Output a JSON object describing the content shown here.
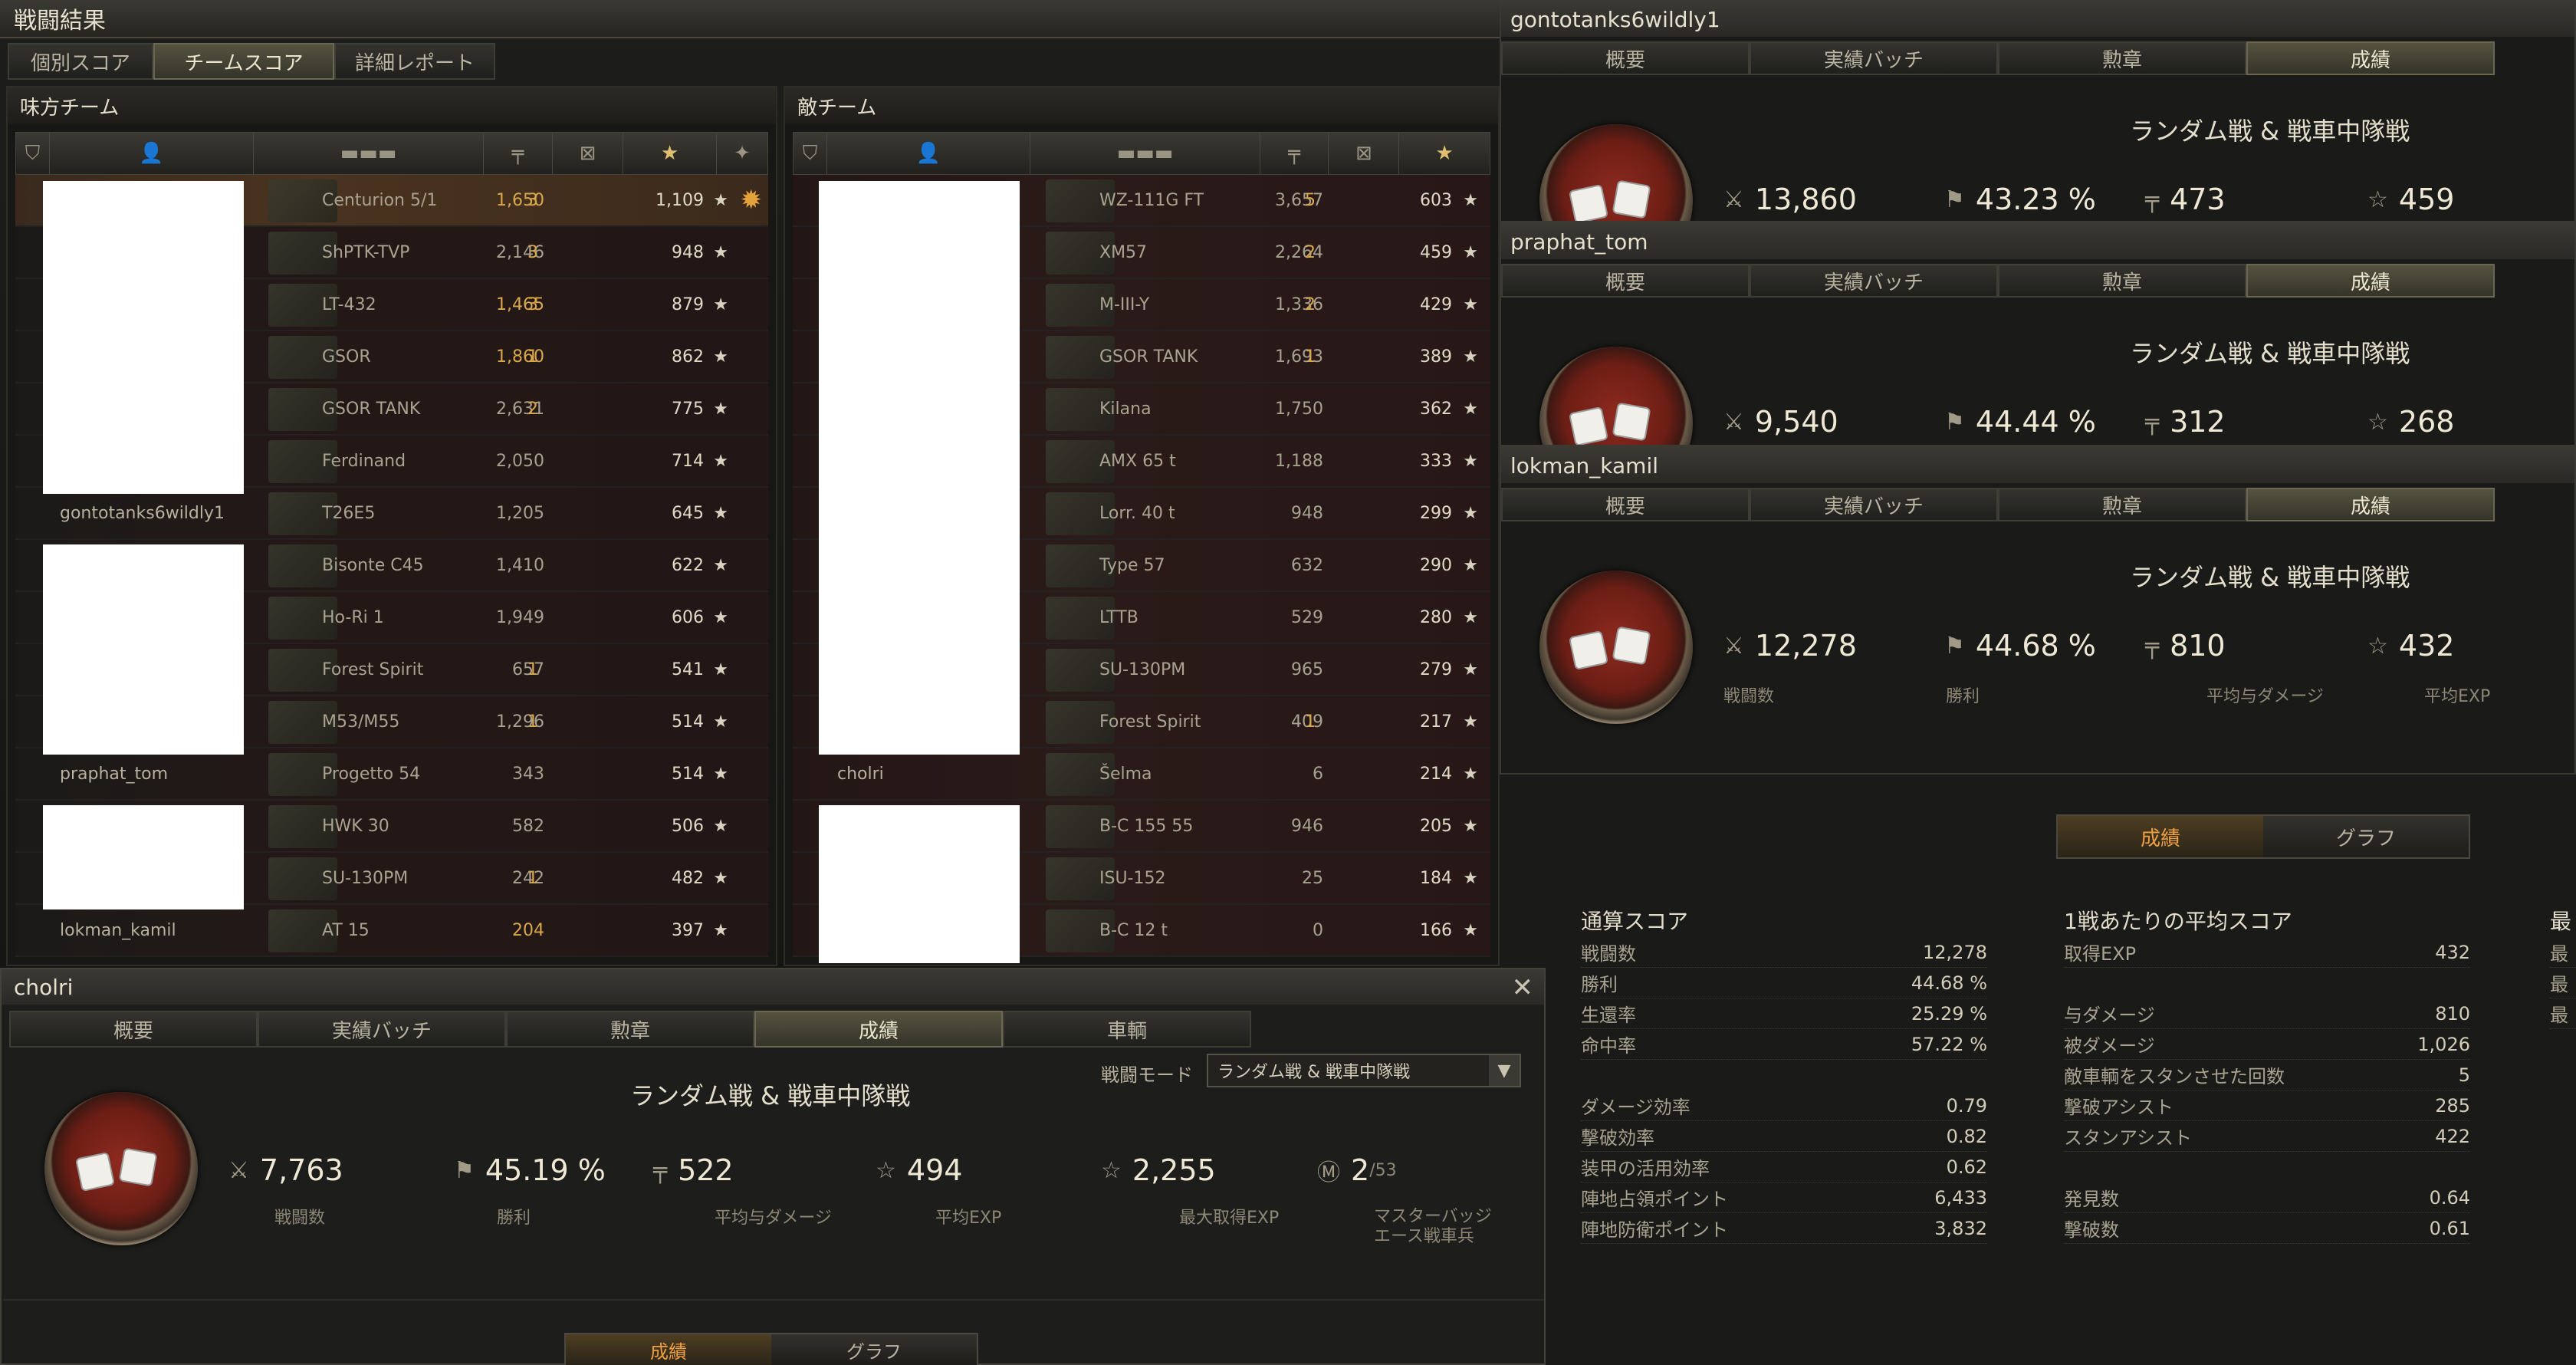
{
  "window": {
    "title": "戦闘結果"
  },
  "main_tabs": [
    {
      "label": "個別スコア",
      "active": false
    },
    {
      "label": "チームスコア",
      "active": true
    },
    {
      "label": "詳細レポート",
      "active": false
    }
  ],
  "ally": {
    "title": "味方チーム",
    "rows": [
      {
        "player": "",
        "tank": "Centurion 5/1",
        "damage": "1,650",
        "kills": "3",
        "xp": "1,109",
        "dmg_hi": true,
        "me": true,
        "badge": true
      },
      {
        "player": "",
        "tank": "ShPTK-TVP",
        "damage": "2,146",
        "kills": "3",
        "xp": "948",
        "dmg_hi": false
      },
      {
        "player": "",
        "tank": "LT-432",
        "damage": "1,465",
        "kills": "3",
        "xp": "879",
        "dmg_hi": true
      },
      {
        "player": "",
        "tank": "GSOR",
        "damage": "1,860",
        "kills": "1",
        "xp": "862",
        "dmg_hi": true
      },
      {
        "player": "",
        "tank": "GSOR TANK",
        "damage": "2,631",
        "kills": "2",
        "xp": "775",
        "dmg_hi": false
      },
      {
        "player": "",
        "tank": "Ferdinand",
        "damage": "2,050",
        "kills": "",
        "xp": "714",
        "dmg_hi": false
      },
      {
        "player": "gontotanks6wildly1",
        "tank": "T26E5",
        "damage": "1,205",
        "kills": "",
        "xp": "645",
        "dmg_hi": false
      },
      {
        "player": "",
        "tank": "Bisonte C45",
        "damage": "1,410",
        "kills": "",
        "xp": "622",
        "dmg_hi": false
      },
      {
        "player": "",
        "tank": "Ho-Ri 1",
        "damage": "1,949",
        "kills": "",
        "xp": "606",
        "dmg_hi": false
      },
      {
        "player": "",
        "tank": "Forest Spirit",
        "damage": "657",
        "kills": "1",
        "xp": "541",
        "dmg_hi": false
      },
      {
        "player": "",
        "tank": "M53/M55",
        "damage": "1,296",
        "kills": "1",
        "xp": "514",
        "dmg_hi": false
      },
      {
        "player": "praphat_tom",
        "tank": "Progetto 54",
        "damage": "343",
        "kills": "",
        "xp": "514",
        "dmg_hi": false
      },
      {
        "player": "",
        "tank": "HWK 30",
        "damage": "582",
        "kills": "",
        "xp": "506",
        "dmg_hi": false
      },
      {
        "player": "",
        "tank": "SU-130PM",
        "damage": "242",
        "kills": "1",
        "xp": "482",
        "dmg_hi": false
      },
      {
        "player": "lokman_kamil",
        "tank": "AT 15",
        "damage": "204",
        "kills": "",
        "xp": "397",
        "dmg_hi": true
      }
    ]
  },
  "enemy": {
    "title": "敵チーム",
    "rows": [
      {
        "player": "",
        "tank": "WZ-111G FT",
        "damage": "3,657",
        "kills": "5",
        "xp": "603"
      },
      {
        "player": "",
        "tank": "XM57",
        "damage": "2,264",
        "kills": "2",
        "xp": "459"
      },
      {
        "player": "",
        "tank": "M-III-Y",
        "damage": "1,336",
        "kills": "2",
        "xp": "429"
      },
      {
        "player": "",
        "tank": "GSOR TANK",
        "damage": "1,693",
        "kills": "1",
        "xp": "389"
      },
      {
        "player": "",
        "tank": "Kilana",
        "damage": "1,750",
        "kills": "",
        "xp": "362"
      },
      {
        "player": "",
        "tank": "AMX 65 t",
        "damage": "1,188",
        "kills": "",
        "xp": "333"
      },
      {
        "player": "",
        "tank": "Lorr. 40 t",
        "damage": "948",
        "kills": "",
        "xp": "299"
      },
      {
        "player": "",
        "tank": "Type 57",
        "damage": "632",
        "kills": "",
        "xp": "290"
      },
      {
        "player": "",
        "tank": "LTTB",
        "damage": "529",
        "kills": "",
        "xp": "280"
      },
      {
        "player": "",
        "tank": "SU-130PM",
        "damage": "965",
        "kills": "",
        "xp": "279"
      },
      {
        "player": "",
        "tank": "Forest Spirit",
        "damage": "409",
        "kills": "1",
        "xp": "217"
      },
      {
        "player": "cholri",
        "tank": "Šelma",
        "damage": "6",
        "kills": "",
        "xp": "214"
      },
      {
        "player": "",
        "tank": "B-C 155 55",
        "damage": "946",
        "kills": "",
        "xp": "205"
      },
      {
        "player": "",
        "tank": "ISU-152",
        "damage": "25",
        "kills": "",
        "xp": "184"
      },
      {
        "player": "",
        "tank": "B-C 12 t",
        "damage": "0",
        "kills": "",
        "xp": "166"
      }
    ]
  },
  "panel_tabs": [
    "概要",
    "実績バッチ",
    "勲章",
    "成績"
  ],
  "panels": [
    {
      "name": "gontotanks6wildly1",
      "mode": "ランダム戦 & 戦車中隊戦",
      "battles": "13,860",
      "winrate": "43.23 %",
      "avg_dmg": "473",
      "avg_xp": "459"
    },
    {
      "name": "praphat_tom",
      "mode": "ランダム戦 & 戦車中隊戦",
      "battles": "9,540",
      "winrate": "44.44 %",
      "avg_dmg": "312",
      "avg_xp": "268"
    },
    {
      "name": "lokman_kamil",
      "mode": "ランダム戦 & 戦車中隊戦",
      "battles": "12,278",
      "winrate": "44.68 %",
      "avg_dmg": "810",
      "avg_xp": "432",
      "labels": {
        "battles": "戦闘数",
        "winrate": "勝利",
        "avg_dmg": "平均与ダメージ",
        "avg_xp": "平均EXP"
      }
    }
  ],
  "switch": {
    "left": "成績",
    "right": "グラフ"
  },
  "totals": {
    "title": "通算スコア",
    "rows": [
      {
        "k": "戦闘数",
        "v": "12,278"
      },
      {
        "k": "勝利",
        "v": "44.68 %"
      },
      {
        "k": "生還率",
        "v": "25.29 %"
      },
      {
        "k": "命中率",
        "v": "57.22 %"
      },
      {
        "k": "",
        "v": ""
      },
      {
        "k": "ダメージ効率",
        "v": "0.79"
      },
      {
        "k": "撃破効率",
        "v": "0.82"
      },
      {
        "k": "装甲の活用効率",
        "v": "0.62"
      },
      {
        "k": "陣地占領ポイント",
        "v": "6,433"
      },
      {
        "k": "陣地防衛ポイント",
        "v": "3,832"
      }
    ]
  },
  "averages": {
    "title": "1戦あたりの平均スコア",
    "rows": [
      {
        "k": "取得EXP",
        "v": "432"
      },
      {
        "k": "",
        "v": ""
      },
      {
        "k": "与ダメージ",
        "v": "810"
      },
      {
        "k": "被ダメージ",
        "v": "1,026"
      },
      {
        "k": "敵車輌をスタンさせた回数",
        "v": "5"
      },
      {
        "k": "撃破アシスト",
        "v": "285"
      },
      {
        "k": "スタンアシスト",
        "v": "422"
      },
      {
        "k": "",
        "v": ""
      },
      {
        "k": "発見数",
        "v": "0.64"
      },
      {
        "k": "撃破数",
        "v": "0.61"
      }
    ]
  },
  "max_col": {
    "title": "最",
    "rows": [
      "最",
      "最",
      "最"
    ]
  },
  "cholri": {
    "name": "cholri",
    "tabs": [
      "概要",
      "実績バッチ",
      "勲章",
      "成績",
      "車輌"
    ],
    "mode_label": "戦闘モード",
    "mode_value": "ランダム戦 & 戦車中隊戦",
    "mode_title": "ランダム戦 & 戦車中隊戦",
    "battles": "7,763",
    "battles_label": "戦闘数",
    "winrate": "45.19 %",
    "winrate_label": "勝利",
    "avg_dmg": "522",
    "avg_dmg_label": "平均与ダメージ",
    "avg_xp": "494",
    "avg_xp_label": "平均EXP",
    "max_xp": "2,255",
    "max_xp_label": "最大取得EXP",
    "mastery": "2",
    "mastery_total": "/53",
    "mastery_label1": "マスターバッジ",
    "mastery_label2": "エース戦車兵",
    "switch_left": "成績",
    "switch_right": "グラフ"
  }
}
